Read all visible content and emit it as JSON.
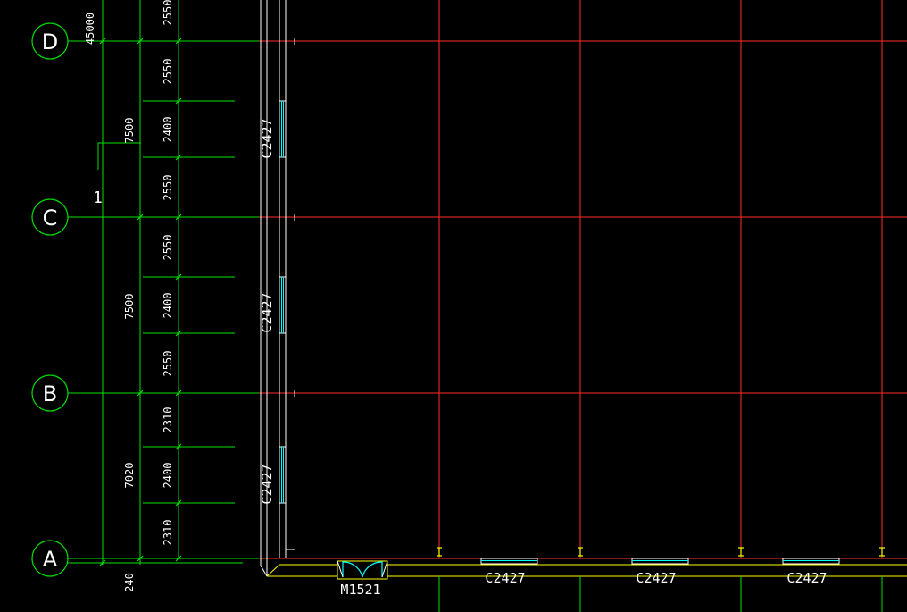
{
  "colors": {
    "background": "#000000",
    "axis_line": "#ff2b2b",
    "dimension": "#00e000",
    "wall": "#ffffff",
    "yellow_line": "#ffff00",
    "window_fill": "#00ffff",
    "text": "#ffffff"
  },
  "axes": {
    "D": "D",
    "C": "C",
    "B": "B",
    "A": "A"
  },
  "dimensions": {
    "overall": "45000",
    "d_top_partial": "2550",
    "dc_upper": "2550",
    "dc_window": "2400",
    "dc_lower": "2550",
    "dc_total": "7500",
    "cb_upper": "2550",
    "cb_window": "2400",
    "cb_lower": "2550",
    "cb_total": "7500",
    "ba_upper": "2310",
    "ba_window": "2400",
    "ba_lower": "2310",
    "ba_total": "7020",
    "wall_thickness": "240"
  },
  "section_mark": "1",
  "windows": {
    "west_1": "C2427",
    "west_2": "C2427",
    "west_3": "C2427",
    "south_1": "C2427",
    "south_2": "C2427",
    "south_3": "C2427"
  },
  "door": "M1521"
}
